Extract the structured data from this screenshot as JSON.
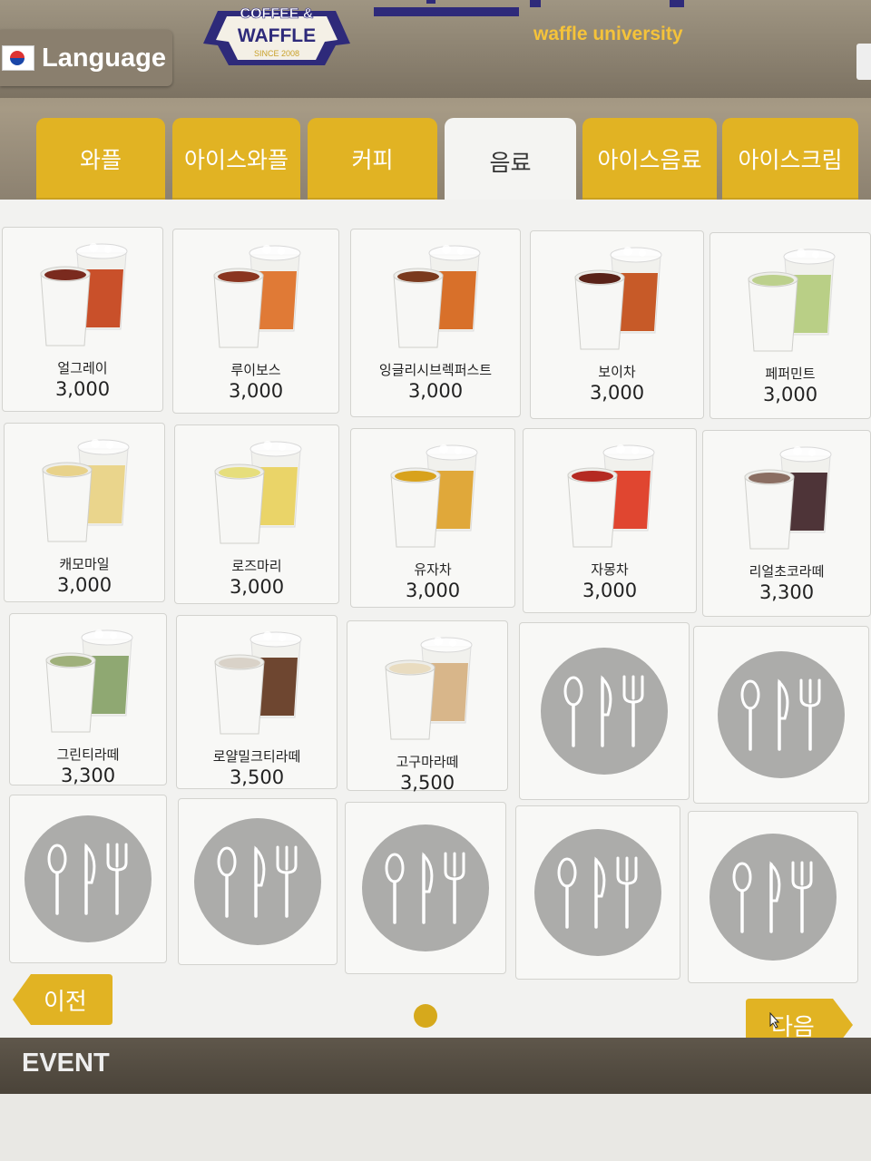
{
  "header": {
    "language_label": "Language",
    "logo_text_top": "COFFEE &",
    "logo_text_main": "WAFFLE",
    "logo_since": "SINCE 2008",
    "brand_en": "waffle university"
  },
  "tabs": [
    {
      "label": "와플",
      "active": false
    },
    {
      "label": "아이스와플",
      "active": false
    },
    {
      "label": "커피",
      "active": false
    },
    {
      "label": "음료",
      "active": true
    },
    {
      "label": "아이스음료",
      "active": false
    },
    {
      "label": "아이스크림",
      "active": false
    }
  ],
  "products": [
    {
      "name": "얼그레이",
      "price": "3,000",
      "hot": "#7a2a1e",
      "iced": "#c9502a"
    },
    {
      "name": "루이보스",
      "price": "3,000",
      "hot": "#8a3520",
      "iced": "#e07a36"
    },
    {
      "name": "잉글리시브렉퍼스트",
      "price": "3,000",
      "hot": "#7a3a1e",
      "iced": "#d8702a"
    },
    {
      "name": "보이차",
      "price": "3,000",
      "hot": "#5a2218",
      "iced": "#c75a28"
    },
    {
      "name": "페퍼민트",
      "price": "3,000",
      "hot": "#bcd08c",
      "iced": "#b9cf86"
    },
    {
      "name": "캐모마일",
      "price": "3,000",
      "hot": "#e8d28a",
      "iced": "#ead58c"
    },
    {
      "name": "로즈마리",
      "price": "3,000",
      "hot": "#e6de7c",
      "iced": "#ead468"
    },
    {
      "name": "유자차",
      "price": "3,000",
      "hot": "#d8a21c",
      "iced": "#e0a83a"
    },
    {
      "name": "자몽차",
      "price": "3,000",
      "hot": "#b52a22",
      "iced": "#e04630"
    },
    {
      "name": "리얼초코라떼",
      "price": "3,300",
      "hot": "#8b6e62",
      "iced": "#4e3438"
    },
    {
      "name": "그린티라떼",
      "price": "3,300",
      "hot": "#9fb07a",
      "iced": "#8fa872"
    },
    {
      "name": "로얄밀크티라떼",
      "price": "3,500",
      "hot": "#d9d2c8",
      "iced": "#6e4630"
    },
    {
      "name": "고구마라떼",
      "price": "3,500",
      "hot": "#e9dcc0",
      "iced": "#d8b68a"
    }
  ],
  "empty_slots": 7,
  "empty_icon": "utensils-icon",
  "nav": {
    "prev_label": "이전",
    "next_label": "다음",
    "page_count": 1
  },
  "event_label": "EVENT",
  "colors": {
    "accent": "#e1b323",
    "brand_navy": "#2e2a7a",
    "panel": "#f2f2f0",
    "placeholder_gray": "#acacaa"
  }
}
